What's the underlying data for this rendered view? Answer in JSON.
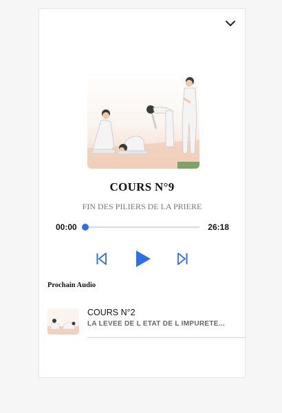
{
  "player": {
    "title": "COURS N°9",
    "subtitle": "FIN DES PILIERS DE LA PRIERE",
    "current_time": "00:00",
    "duration": "26:18",
    "progress_fraction": 0,
    "cover_icon": "prayer-positions-illustration"
  },
  "controls": {
    "collapse_icon": "chevron-down-icon",
    "previous_icon": "skip-previous-icon",
    "play_icon": "play-icon",
    "next_icon": "skip-next-icon",
    "accent_color": "#2f6ee8"
  },
  "queue": {
    "heading": "Prochain Audio",
    "items": [
      {
        "title": "COURS N°2",
        "subtitle": "LA LEVEE DE L ETAT DE L IMPURETE..."
      }
    ]
  }
}
